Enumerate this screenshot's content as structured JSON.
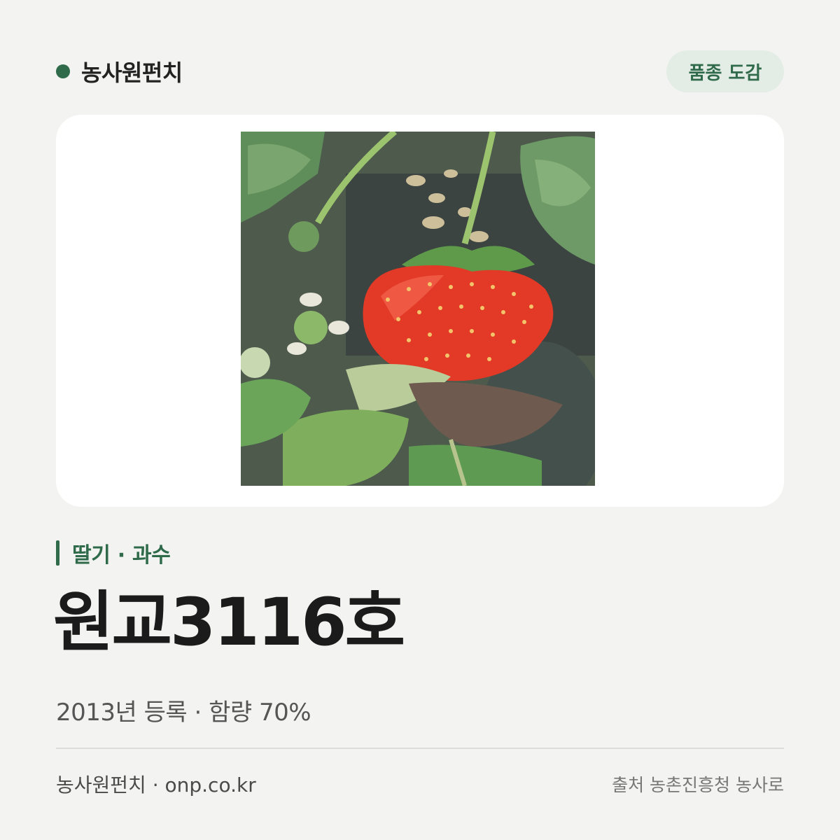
{
  "header": {
    "brand_name": "농사원펀치",
    "tag_label": "품종 도감"
  },
  "photo": {
    "subject": "strawberry-photo"
  },
  "variety": {
    "category": "딸기 · 과수",
    "name": "원교3116호",
    "meta": "2013년 등록 · 함량 70%"
  },
  "footer": {
    "site": "농사원펀치 · onp.co.kr",
    "source": "출처 농촌진흥청 농사로"
  },
  "colors": {
    "accent": "#2f6b4b",
    "pill_bg": "#e4ece6",
    "page_bg": "#f3f3f1"
  }
}
